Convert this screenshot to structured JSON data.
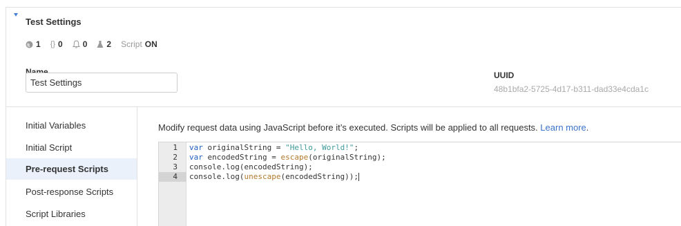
{
  "header": {
    "title": "Test Settings"
  },
  "stats": {
    "globe_count": "1",
    "braces_count": "0",
    "bell_count": "0",
    "flask_count": "2",
    "script_label": "Script",
    "script_value": "ON"
  },
  "form": {
    "name_label": "Name",
    "name_value": "Test Settings",
    "uuid_label": "UUID",
    "uuid_value": "48b1bfa2-5725-4d17-b311-dad33e4cda1c"
  },
  "sidebar": {
    "items": [
      {
        "label": "Initial Variables"
      },
      {
        "label": "Initial Script"
      },
      {
        "label": "Pre-request Scripts"
      },
      {
        "label": "Post-response Scripts"
      },
      {
        "label": "Script Libraries"
      }
    ],
    "active_index": 2
  },
  "main": {
    "description": "Modify request data using JavaScript before it’s executed. Scripts will be applied to all requests.",
    "learn_more": "Learn more",
    "period": "."
  },
  "editor": {
    "line_numbers": [
      "1",
      "2",
      "3",
      "4"
    ],
    "active_line": 4,
    "lines": [
      "var originalString = \"Hello, World!\";",
      "var encodedString = escape(originalString);",
      "console.log(encodedString);",
      "console.log(unescape(encodedString));"
    ]
  },
  "colors": {
    "accent": "#3a73c9",
    "active_bg": "#eaf1fb",
    "keyword": "#1f5cc0",
    "string": "#3f9b9b",
    "function": "#b07a2c"
  }
}
